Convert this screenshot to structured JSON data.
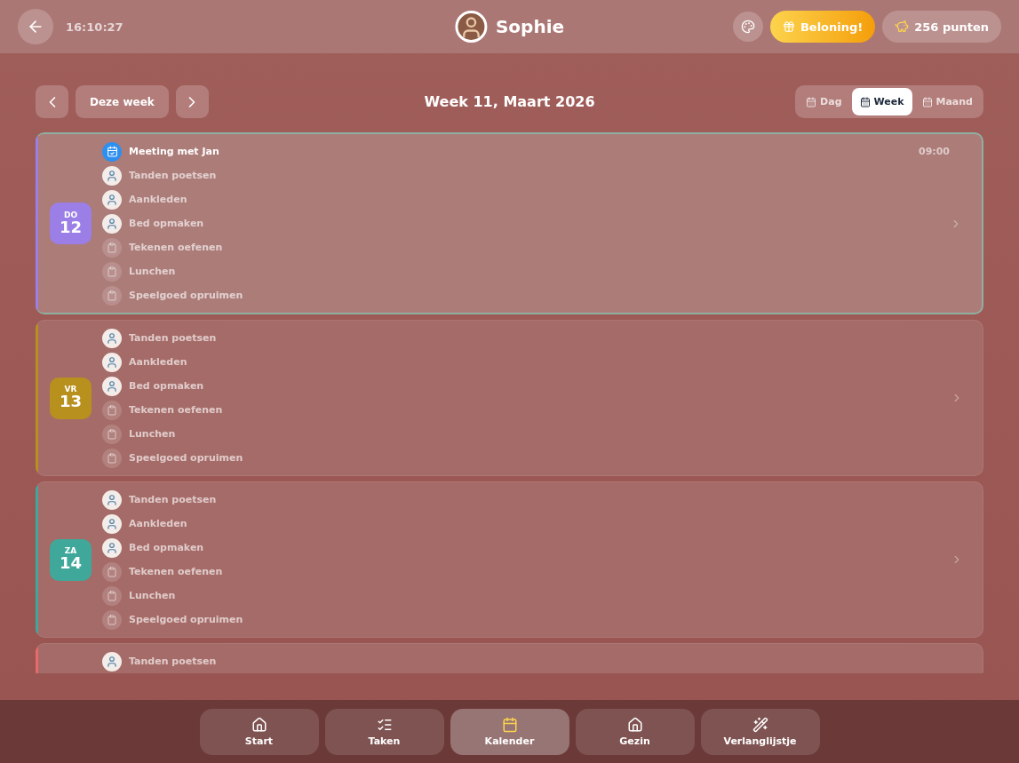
{
  "header": {
    "time": "16:10:27",
    "user_name": "Sophie",
    "reward_label": "Beloning!",
    "points": "256 punten"
  },
  "toolbar": {
    "today_button": "Deze week",
    "title": "Week 11, Maart 2026",
    "views": [
      {
        "label": "Dag",
        "selected": false
      },
      {
        "label": "Week",
        "selected": true
      },
      {
        "label": "Maand",
        "selected": false
      }
    ]
  },
  "days": [
    {
      "weekday": "DO",
      "date": "12",
      "color": "#9b7fe6",
      "today": true,
      "items": [
        {
          "kind": "event",
          "title": "Meeting met Jan",
          "time": "09:00"
        },
        {
          "kind": "picture",
          "title": "Tanden poetsen"
        },
        {
          "kind": "picture",
          "title": "Aankleden"
        },
        {
          "kind": "picture",
          "title": "Bed opmaken"
        },
        {
          "kind": "task",
          "title": "Tekenen oefenen"
        },
        {
          "kind": "task",
          "title": "Lunchen"
        },
        {
          "kind": "task",
          "title": "Speelgoed opruimen"
        }
      ]
    },
    {
      "weekday": "VR",
      "date": "13",
      "color": "#b8901e",
      "today": false,
      "items": [
        {
          "kind": "picture",
          "title": "Tanden poetsen"
        },
        {
          "kind": "picture",
          "title": "Aankleden"
        },
        {
          "kind": "picture",
          "title": "Bed opmaken"
        },
        {
          "kind": "task",
          "title": "Tekenen oefenen"
        },
        {
          "kind": "task",
          "title": "Lunchen"
        },
        {
          "kind": "task",
          "title": "Speelgoed opruimen"
        }
      ]
    },
    {
      "weekday": "ZA",
      "date": "14",
      "color": "#3fa89a",
      "today": false,
      "items": [
        {
          "kind": "picture",
          "title": "Tanden poetsen"
        },
        {
          "kind": "picture",
          "title": "Aankleden"
        },
        {
          "kind": "picture",
          "title": "Bed opmaken"
        },
        {
          "kind": "task",
          "title": "Tekenen oefenen"
        },
        {
          "kind": "task",
          "title": "Lunchen"
        },
        {
          "kind": "task",
          "title": "Speelgoed opruimen"
        }
      ]
    },
    {
      "color": "#e86a6a",
      "today": false,
      "items": [
        {
          "kind": "picture",
          "title": "Tanden poetsen"
        }
      ]
    }
  ],
  "nav": [
    {
      "label": "Start",
      "selected": false
    },
    {
      "label": "Taken",
      "selected": false
    },
    {
      "label": "Kalender",
      "selected": true
    },
    {
      "label": "Gezin",
      "selected": false
    },
    {
      "label": "Verlanglijstje",
      "selected": false
    }
  ]
}
